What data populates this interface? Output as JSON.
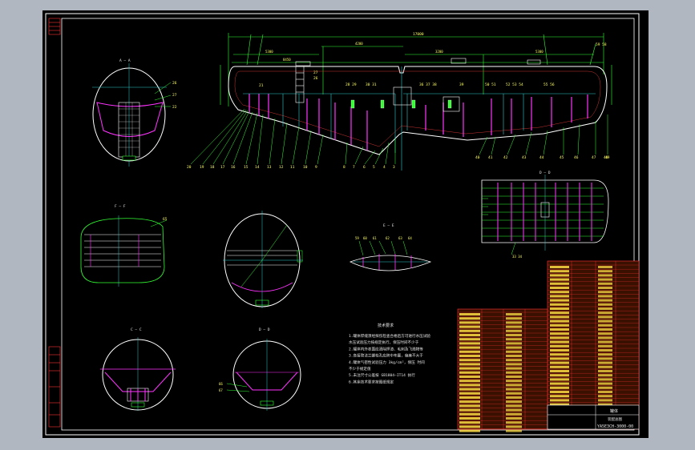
{
  "section_labels": {
    "aa": "A — A",
    "ff": "F — F",
    "bb": "B — B",
    "cc": "C — C",
    "dd": "D — D",
    "ee": "E — E"
  },
  "top_dims": {
    "overall": "17000",
    "left": "5300",
    "right": "5300",
    "mid": "4200",
    "mid2": "3200",
    "center": "8450"
  },
  "notes": {
    "title": "技术要求",
    "lines": [
      "1.罐体焊缝须经探伤检查合格后方可进行水压试验",
      "  水压试验压力按规定执行，保压时间不少于",
      "2.罐体内外表面应清除焊渣、毛刺及飞溅物等",
      "3.各接管法兰螺栓孔应跨中布置，偏差不大于",
      "4.罐体气密性试验压力 3kg/cm²，保压 时间",
      "  不少于规定值",
      "5.未注尺寸公差按 GB1804—IT14 执行",
      "6.其余技术要求按图纸规定"
    ]
  },
  "callouts_left": [
    "20",
    "19",
    "18",
    "17",
    "16",
    "15",
    "14",
    "13",
    "12",
    "11",
    "10",
    "9",
    "8",
    "7",
    "6",
    "5",
    "4",
    "3"
  ],
  "callouts_right": [
    "40",
    "41",
    "42",
    "43",
    "44",
    "45",
    "46",
    "47",
    "48",
    "49"
  ],
  "title_block": {
    "drawing_no": "YA5E3CH-3000-00",
    "name": "罐体",
    "sub": "装配总图"
  },
  "colors": {
    "sheet": "#000000",
    "frame": "#ffffff",
    "outline": "#ffffff",
    "green": "#33ff33",
    "magenta": "#ff33ff",
    "cyan": "#33cccc",
    "yellow": "#ffff66",
    "red": "#ff2a2a"
  }
}
